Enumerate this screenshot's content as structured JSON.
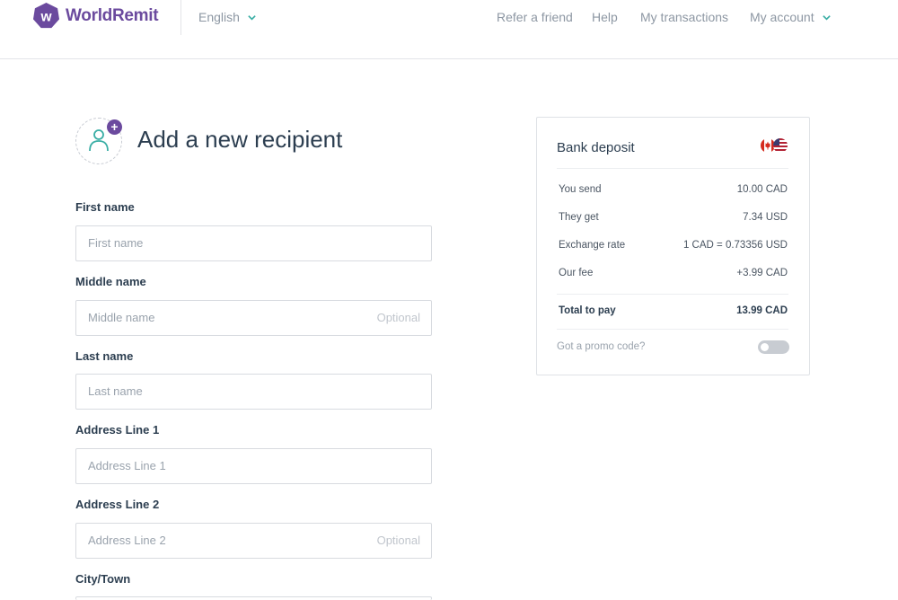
{
  "header": {
    "brand_name": "WorldRemit",
    "logo_letter": "w",
    "brand_color": "#6b4a9e",
    "language": "English",
    "nav": {
      "refer": "Refer a friend",
      "help": "Help",
      "transactions": "My transactions",
      "account": "My account"
    }
  },
  "page": {
    "title": "Add a new recipient",
    "avatar_icon": "person-add-icon"
  },
  "form": {
    "optional_text": "Optional",
    "fields": [
      {
        "label": "First name",
        "placeholder": "First name",
        "value": "",
        "optional": false
      },
      {
        "label": "Middle name",
        "placeholder": "Middle name",
        "value": "",
        "optional": true
      },
      {
        "label": "Last name",
        "placeholder": "Last name",
        "value": "",
        "optional": false
      },
      {
        "label": "Address Line 1",
        "placeholder": "Address Line 1",
        "value": "",
        "optional": false
      },
      {
        "label": "Address Line 2",
        "placeholder": "Address Line 2",
        "value": "",
        "optional": true
      },
      {
        "label": "City/Town"
      }
    ]
  },
  "summary": {
    "title": "Bank deposit",
    "flags": [
      "canada-flag-icon",
      "usa-flag-icon"
    ],
    "rows": [
      {
        "label": "You send",
        "value": "10.00 CAD"
      },
      {
        "label": "They get",
        "value": "7.34 USD"
      },
      {
        "label": "Exchange rate",
        "value": "1 CAD = 0.73356 USD"
      },
      {
        "label": "Our fee",
        "value": "+3.99 CAD"
      }
    ],
    "total": {
      "label": "Total to pay",
      "value": "13.99 CAD"
    },
    "promo_label": "Got a promo code?",
    "promo_enabled": false
  }
}
